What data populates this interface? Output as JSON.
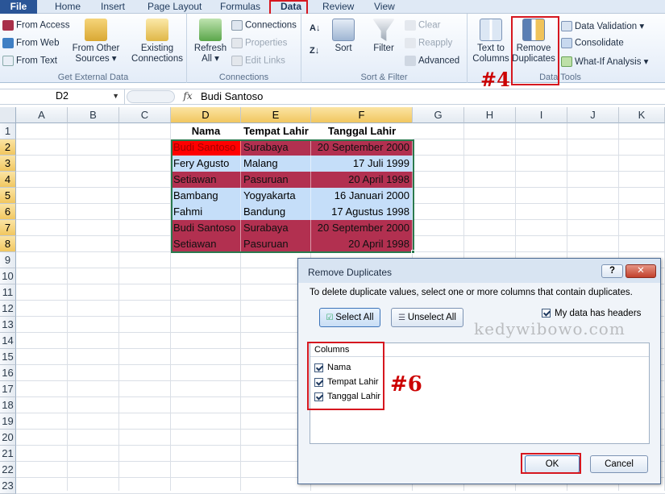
{
  "tabs": [
    {
      "label": "File"
    },
    {
      "label": "Home"
    },
    {
      "label": "Insert"
    },
    {
      "label": "Page Layout"
    },
    {
      "label": "Formulas"
    },
    {
      "label": "Data"
    },
    {
      "label": "Review"
    },
    {
      "label": "View"
    }
  ],
  "ribbon": {
    "get_external": {
      "label": "Get External Data",
      "from_access": "From Access",
      "from_web": "From Web",
      "from_text": "From Text",
      "from_other_l1": "From Other",
      "from_other_l2": "Sources ▾",
      "existing_l1": "Existing",
      "existing_l2": "Connections"
    },
    "connections": {
      "label": "Connections",
      "refresh_l1": "Refresh",
      "refresh_l2": "All ▾",
      "connections": "Connections",
      "properties": "Properties",
      "edit_links": "Edit Links"
    },
    "sort_filter": {
      "label": "Sort & Filter",
      "sort": "Sort",
      "filter": "Filter",
      "clear": "Clear",
      "reapply": "Reapply",
      "advanced": "Advanced"
    },
    "data_tools": {
      "label": "Data Tools",
      "ttc_l1": "Text to",
      "ttc_l2": "Columns",
      "rd_l1": "Remove",
      "rd_l2": "Duplicates",
      "validation": "Data Validation ▾",
      "consolidate": "Consolidate",
      "whatif": "What-If Analysis ▾"
    }
  },
  "formula_bar": {
    "cell_ref": "D2",
    "fx": "fx",
    "value": "Budi Santoso"
  },
  "columns": [
    "A",
    "B",
    "C",
    "D",
    "E",
    "F",
    "G",
    "H",
    "I",
    "J",
    "K"
  ],
  "rows": [
    "1",
    "2",
    "3",
    "4",
    "5",
    "6",
    "7",
    "8",
    "9",
    "10",
    "11",
    "12",
    "13",
    "14",
    "15",
    "16",
    "17",
    "18",
    "19",
    "20",
    "21",
    "22",
    "23"
  ],
  "table": {
    "headers": [
      "Nama",
      "Tempat Lahir",
      "Tanggal Lahir"
    ],
    "rows": [
      {
        "nama": "Budi Santoso",
        "tempat": "Surabaya",
        "tanggal": "20 September 2000"
      },
      {
        "nama": "Fery Agusto",
        "tempat": "Malang",
        "tanggal": "17 Juli 1999"
      },
      {
        "nama": "Setiawan",
        "tempat": "Pasuruan",
        "tanggal": "20 April 1998"
      },
      {
        "nama": "Bambang",
        "tempat": "Yogyakarta",
        "tanggal": "16 Januari 2000"
      },
      {
        "nama": "Fahmi",
        "tempat": "Bandung",
        "tanggal": "17 Agustus 1998"
      },
      {
        "nama": "Budi Santoso",
        "tempat": "Surabaya",
        "tanggal": "20 September 2000"
      },
      {
        "nama": "Setiawan",
        "tempat": "Pasuruan",
        "tanggal": "20 April 1998"
      }
    ]
  },
  "dialog": {
    "title": "Remove Duplicates",
    "help": "?",
    "close": "✕",
    "instruction": "To delete duplicate values, select one or more columns that contain duplicates.",
    "select_all": "Select All",
    "unselect_all": "Unselect All",
    "headers_label": "My data has headers",
    "columns_label": "Columns",
    "columns": [
      "Nama",
      "Tempat Lahir",
      "Tanggal Lahir"
    ],
    "ok": "OK",
    "cancel": "Cancel"
  },
  "annotations": {
    "step4": "#4",
    "step6": "#6",
    "watermark": "kedywibowo.com"
  },
  "colors": {
    "duplicate_row": "#b23050",
    "unique_row": "#c5def9",
    "active_cell": "#ff0000",
    "highlight": "#d6171f"
  }
}
